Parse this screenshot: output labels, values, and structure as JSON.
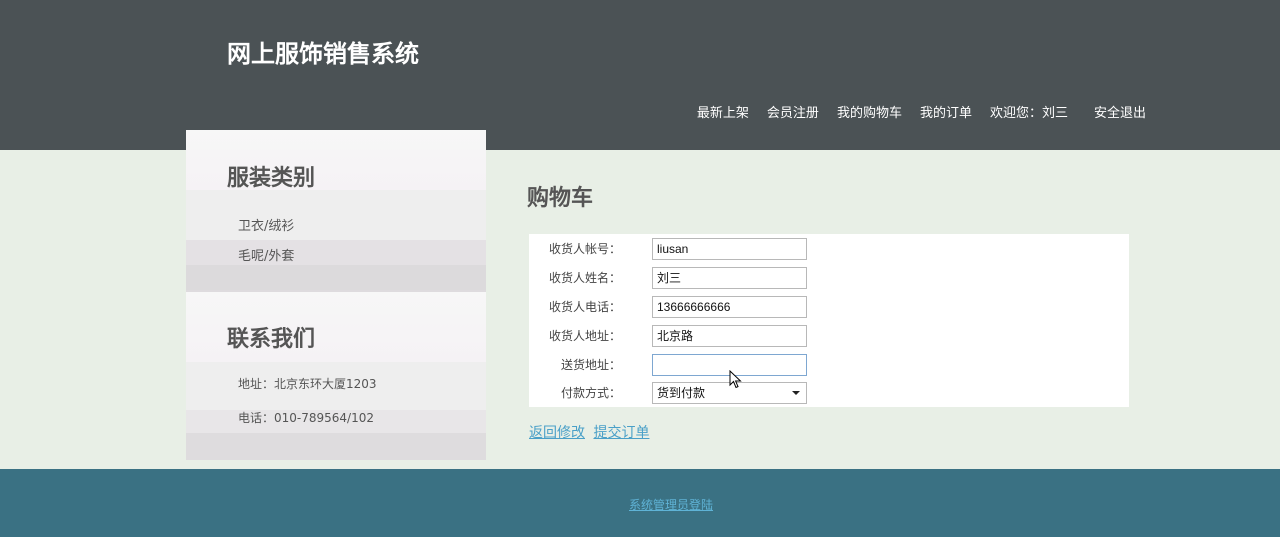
{
  "header": {
    "site_title": "网上服饰销售系统",
    "nav": [
      "最新上架",
      "会员注册",
      "我的购物车",
      "我的订单"
    ],
    "welcome": "欢迎您：刘三",
    "logout": "安全退出"
  },
  "sidebar": {
    "categories_title": "服装类别",
    "categories": [
      "卫衣/绒衫",
      "毛呢/外套"
    ],
    "contact_title": "联系我们",
    "contact_info": [
      "地址：北京东环大厦1203",
      "电话：010-789564/102"
    ]
  },
  "main": {
    "title": "购物车",
    "form": {
      "account_label": "收货人帐号：",
      "account_value": "liusan",
      "name_label": "收货人姓名：",
      "name_value": "刘三",
      "phone_label": "收货人电话：",
      "phone_value": "13666666666",
      "address_label": "收货人地址：",
      "address_value": "北京路",
      "delivery_label": "送货地址：",
      "delivery_value": "",
      "payment_label": "付款方式：",
      "payment_value": "货到付款"
    },
    "actions": {
      "back": "返回修改",
      "submit": "提交订单"
    }
  },
  "footer": {
    "admin_login": "系统管理员登陆"
  }
}
